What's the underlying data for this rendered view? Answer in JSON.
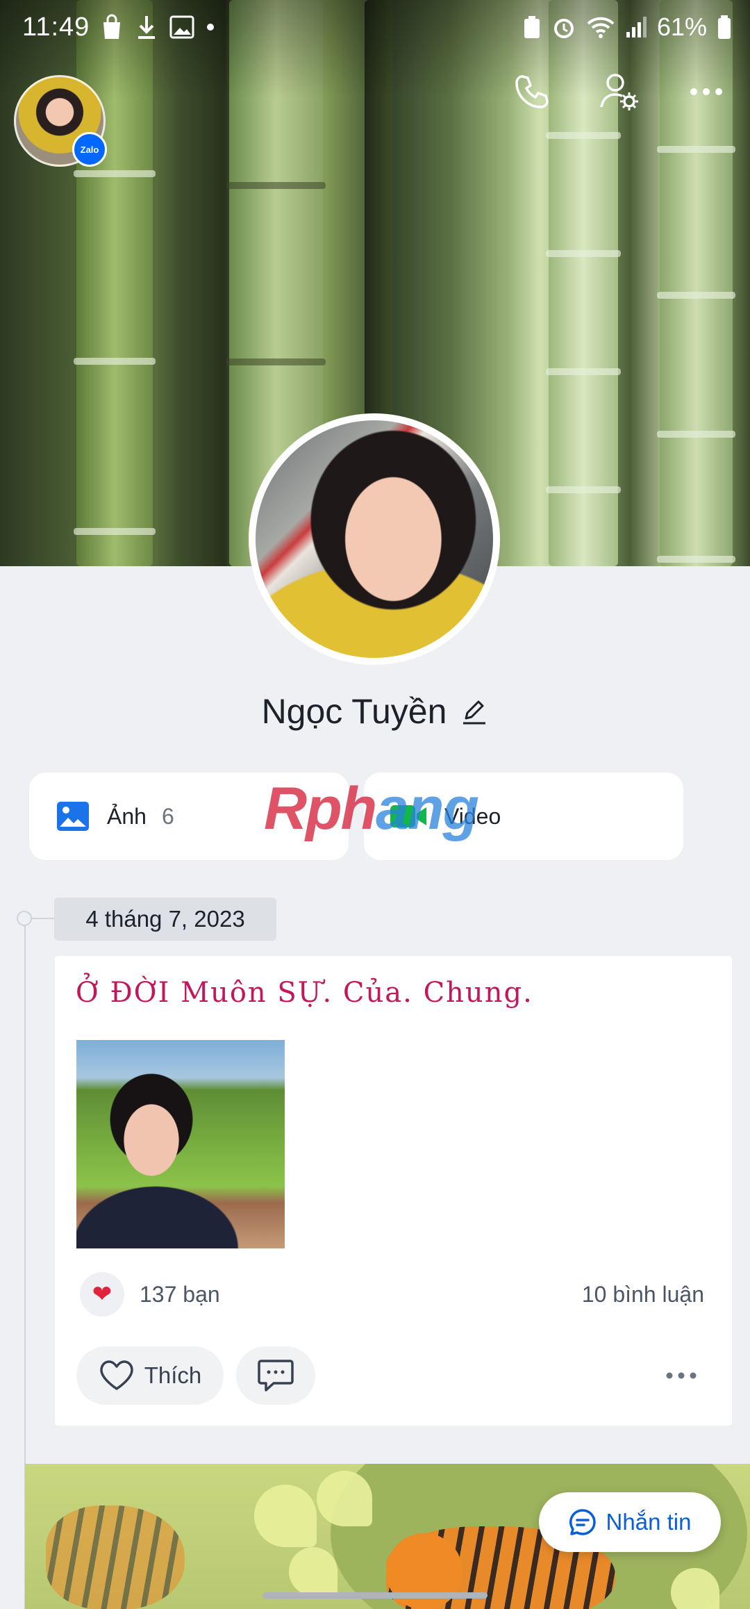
{
  "status_bar": {
    "time": "11:49",
    "battery": "61%"
  },
  "profile": {
    "name": "Ngọc Tuyền",
    "zalo_badge": "Zalo"
  },
  "media_tabs": {
    "photos_label": "Ảnh",
    "photos_count": "6",
    "video_label": "Video"
  },
  "watermark": {
    "part1": "Rph",
    "part2": "ang"
  },
  "timeline": {
    "date": "4 tháng 7, 2023"
  },
  "post": {
    "text": "Ở ĐỜI Muôn SỰ. Của. Chung.",
    "likes": "137 bạn",
    "comments": "10 bình luận",
    "like_label": "Thích"
  },
  "message_button": {
    "label": "Nhắn tin"
  },
  "colors": {
    "accent": "#0a5ed8",
    "post_text": "#c2185b",
    "heart": "#e0243b"
  }
}
